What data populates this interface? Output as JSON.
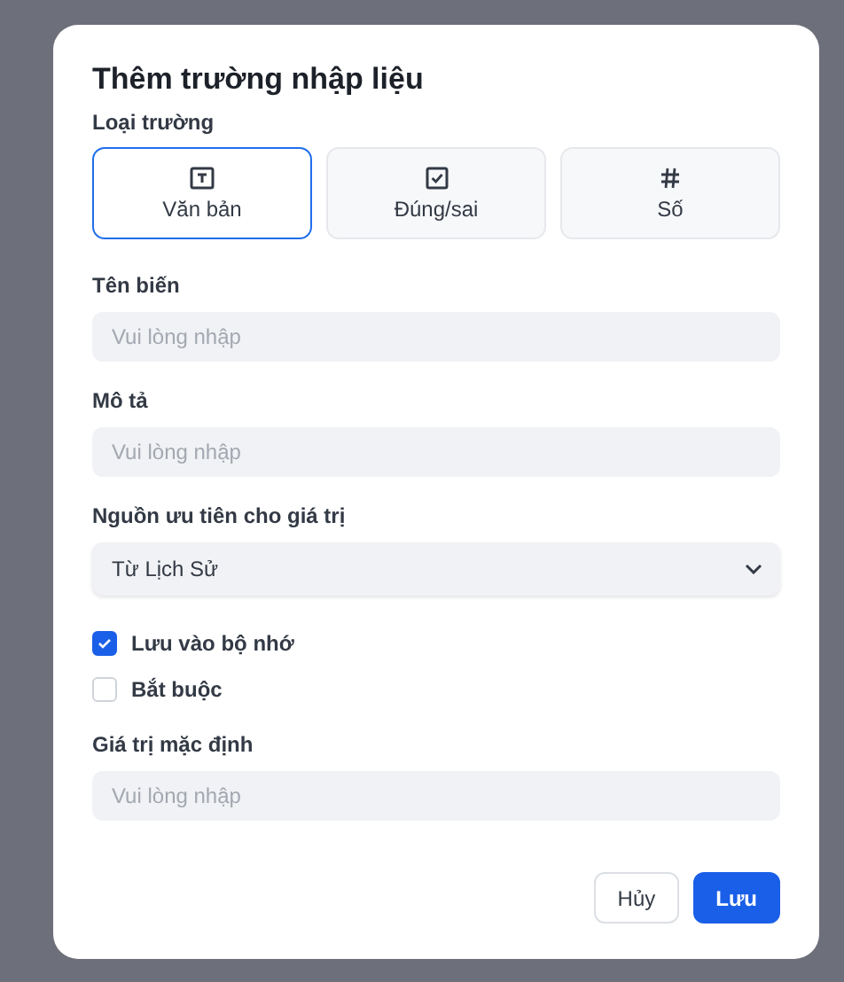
{
  "dialog": {
    "title": "Thêm trường nhập liệu",
    "type_label": "Loại trường",
    "types": [
      {
        "kind": "text",
        "label": "Văn bản",
        "selected": true
      },
      {
        "kind": "boolean",
        "label": "Đúng/sai",
        "selected": false
      },
      {
        "kind": "number",
        "label": "Số",
        "selected": false
      }
    ],
    "fields": [
      {
        "kind": "input",
        "label": "Tên biến",
        "placeholder": "Vui lòng nhập"
      },
      {
        "kind": "input",
        "label": "Mô tả",
        "placeholder": "Vui lòng nhập"
      },
      {
        "kind": "select",
        "label": "Nguồn ưu tiên cho giá trị",
        "value": "Từ Lịch Sử"
      }
    ],
    "checkboxes": [
      {
        "label": "Lưu vào bộ nhớ",
        "checked": true
      },
      {
        "label": "Bắt buộc",
        "checked": false
      }
    ],
    "default_field": {
      "label": "Giá trị mặc định",
      "placeholder": "Vui lòng nhập"
    },
    "buttons": [
      {
        "kind": "secondary",
        "label": "Hủy"
      },
      {
        "kind": "primary",
        "label": "Lưu"
      }
    ]
  }
}
